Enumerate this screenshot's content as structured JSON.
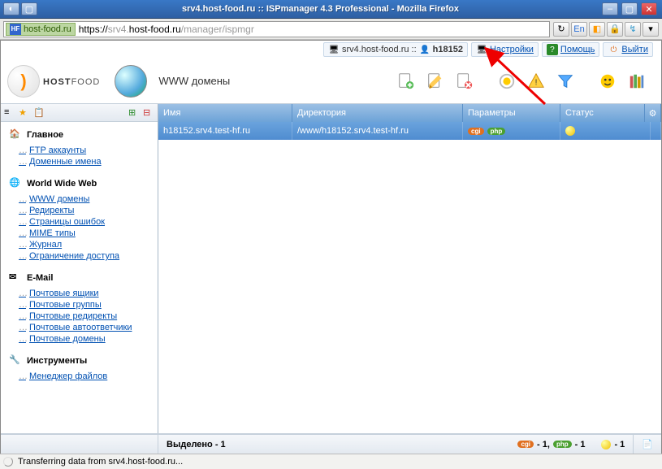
{
  "window": {
    "title": "srv4.host-food.ru :: ISPmanager 4.3 Professional - Mozilla Firefox"
  },
  "address": {
    "site_label": "host-food.ru",
    "proto": "https://",
    "host_gray": "srv4.",
    "host_main": "host-food.ru",
    "path": "/manager/ispmgr"
  },
  "topnav": {
    "server": "srv4.host-food.ru ::",
    "user_icon": "user",
    "user": "h18152",
    "settings": "Настройки",
    "help": "Помощь",
    "logout": "Выйти"
  },
  "brand": {
    "name_bold": "HOST",
    "name_rest": "FOOD"
  },
  "section_title": "WWW домены",
  "sidebar": {
    "sections": [
      {
        "icon": "home",
        "title": "Главное",
        "items": [
          "FTP аккаунты",
          "Доменные имена"
        ]
      },
      {
        "icon": "globe",
        "title": "World Wide Web",
        "items": [
          "WWW домены",
          "Редиректы",
          "Страницы ошибок",
          "MIME типы",
          "Журнал",
          "Ограничение доступа"
        ]
      },
      {
        "icon": "mail",
        "title": "E-Mail",
        "items": [
          "Почтовые ящики",
          "Почтовые группы",
          "Почтовые редиректы",
          "Почтовые автоответчики",
          "Почтовые домены"
        ]
      },
      {
        "icon": "tools",
        "title": "Инструменты",
        "items": [
          "Менеджер файлов"
        ]
      }
    ]
  },
  "columns": {
    "name": "Имя",
    "dir": "Директория",
    "params": "Параметры",
    "status": "Статус"
  },
  "rows": [
    {
      "name": "h18152.srv4.test-hf.ru",
      "dir": "/www/h18152.srv4.test-hf.ru",
      "cgi": "cgi",
      "php": "php"
    }
  ],
  "footer": {
    "selected_label": "Выделено - 1",
    "cgi_count": "- 1,",
    "php_count": "- 1",
    "bulb_count": "- 1"
  },
  "status": "Transferring data from srv4.host-food.ru..."
}
